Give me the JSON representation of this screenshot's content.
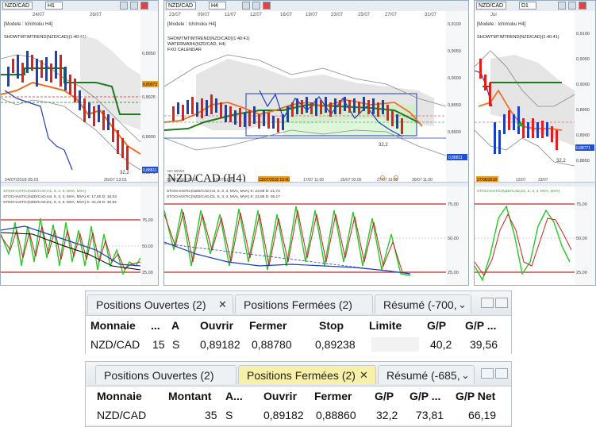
{
  "charts": [
    {
      "symbol": "NZD/CAD",
      "timeframe": "H1",
      "date_labels": [
        "24/07",
        "26/07"
      ],
      "legend": [
        "[Modele : Ichimoku H4]",
        "SHOWTMTIMTREND(NZD/CAD)(1:40:41)"
      ],
      "price_labels": [
        "0,8950",
        "0,8925",
        "0,8900",
        "0,8875"
      ],
      "tags": [
        "0,89073",
        "0,88811"
      ],
      "annotation": "32,2",
      "bottom_dates": [
        "24/07/2018 05:01",
        "26/07 13:01"
      ],
      "osc_legend": [
        "STOCHASTIC(NZD/CAD,H1, 5, 3, 3, MVA, MVA)",
        "STOCHASTIC(NZD/CAD,H4, 5, 3, 3, MVA, MVA) K: 17,50 D: 16,03",
        "STOCHASTIC(NZD/CAD,D1, 5, 3, 3, MVA, MVA) K: 34,16 D: 30,82"
      ],
      "osc_labels": [
        "75,00",
        "50,00",
        "25,00"
      ]
    },
    {
      "symbol": "NZD/CAD",
      "timeframe": "H4",
      "date_labels": [
        "23/07",
        "09/07",
        "11/07",
        "12/07",
        "16/07",
        "19/07",
        "23/07",
        "25/07",
        "27/07",
        "31/07"
      ],
      "legend": [
        "[Modele : Ichimoku H4]",
        "SHOWTMTIMTREND(NZD/CAD)(1:40:41)",
        "WATERMARK(NZD/CAD, H4)",
        "FXO CALENDAR"
      ],
      "price_labels": [
        "0,9100",
        "0,9050",
        "0,9000",
        "0,8950",
        "0,8900",
        "0,8850"
      ],
      "tags": [
        "0,88811"
      ],
      "watermark": "NZD/CAD (H4)",
      "watermark_sub": "NO NEWS",
      "annotation": "32,2",
      "bottom_dates": [
        "03/07/2018 23:00",
        "10/07 11:00",
        "23/07/2018 15:00",
        "17/07 11:00",
        "25/07 03:00",
        "27/07 19:00",
        "30/07 11:00"
      ],
      "osc_legend": [
        "STOCHASTIC(NZD/CAD,H4, 5, 3, 3, MVA, MVA) K: 23,69 D: 21,72",
        "STOCHASTIC(NZD/CAD,D1, 5, 3, 3, MVA, MVA) K: 22,65 D: 36,17"
      ],
      "osc_labels": [
        "75,00",
        "50,00",
        "25,00"
      ]
    },
    {
      "symbol": "NZD/CAD",
      "timeframe": "D1",
      "date_labels": [
        "Jul"
      ],
      "legend": [
        "[Modele : Ichimoku H4]",
        "SHOWTMTIMTREND(NZD/CAD)(1:40:41)"
      ],
      "price_labels": [
        "0,9100",
        "0,9050",
        "0,9000",
        "0,8950",
        "0,8900",
        "0,8850"
      ],
      "tags": [
        "0,88771"
      ],
      "annotation": "32,2",
      "bottom_dates": [
        "27/06/2018",
        "12/07",
        "23/07"
      ],
      "osc_legend": [
        "STOCHASTIC(NZD/CAD,D1, 5, 3, 3, MVA, MVA)"
      ],
      "osc_labels": [
        "75,00",
        "50,00",
        "25,00"
      ]
    }
  ],
  "open_positions": {
    "tabs": [
      "Positions Ouvertes (2)",
      "Positions Fermées (2)",
      "Résumé (-700,"
    ],
    "columns": [
      "Monnaie",
      "...",
      "A",
      "Ouvrir",
      "Fermer",
      "Stop",
      "Limite",
      "G/P",
      "G/P ..."
    ],
    "rows": [
      [
        "NZD/CAD",
        "15",
        "S",
        "0,89182",
        "0,88780",
        "0,89238",
        "",
        "40,2",
        "39,56"
      ]
    ]
  },
  "closed_positions": {
    "tabs": [
      "Positions Ouvertes (2)",
      "Positions Fermées (2)",
      "Résumé (-685,"
    ],
    "columns": [
      "Monnaie",
      "Montant",
      "A...",
      "Ouvrir",
      "Fermer",
      "G/P",
      "G/P ...",
      "G/P Net"
    ],
    "rows": [
      [
        "NZD/CAD",
        "35",
        "S",
        "0,89182",
        "0,88860",
        "32,2",
        "73,81",
        "66,19"
      ]
    ]
  },
  "colors": {
    "up_candle": "#1a3fbf",
    "down_candle": "#e02020",
    "kijun": "#1e7a1e",
    "tenkan": "#f07020",
    "band": "#888888",
    "active_tab": "#f8f0a8",
    "osc_green": "#22cc22",
    "osc_red": "#cc2222"
  }
}
